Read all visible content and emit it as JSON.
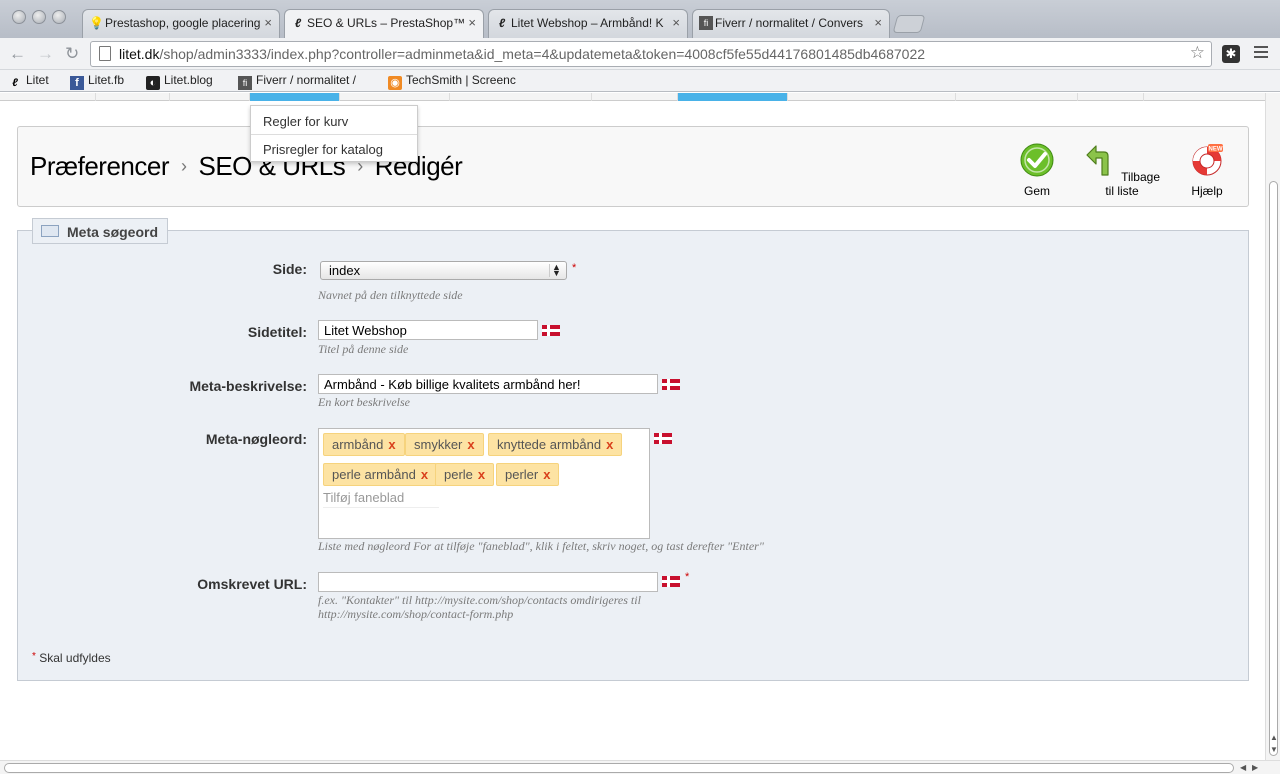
{
  "browser": {
    "tabs": [
      {
        "title": "Prestashop, google placering",
        "icon": "lightbulb-icon",
        "close": "×"
      },
      {
        "title": "SEO & URLs – PrestaShop™",
        "icon": "litet-logo-icon",
        "close": "×"
      },
      {
        "title": "Litet Webshop – Armbånd! K",
        "icon": "litet-logo-icon",
        "close": "×"
      },
      {
        "title": "Fiverr / normalitet / Convers",
        "icon": "fiverr-icon",
        "close": "×"
      }
    ],
    "url_host": "litet.dk",
    "url_path": "/shop/admin3333/index.php?controller=adminmeta&id_meta=4&updatemeta&token=4008cf5fe55d44176801485db4687022",
    "bookmarks": [
      {
        "label": "Litet",
        "icon": "litet-logo-icon"
      },
      {
        "label": "Litet.fb",
        "icon": "facebook-icon"
      },
      {
        "label": "Litet.blog",
        "icon": "blog-icon"
      },
      {
        "label": "Fiverr / normalitet /",
        "icon": "fiverr-icon"
      },
      {
        "label": "TechSmith | Screenc",
        "icon": "rss-icon"
      }
    ]
  },
  "dropdown": {
    "items": [
      "Regler for kurv",
      "Prisregler for katalog"
    ]
  },
  "header": {
    "breadcrumb": [
      "Præferencer",
      "SEO & URLs",
      "Redigér"
    ],
    "breadcrumb_sep": "›",
    "save_label": "Gem",
    "back_label": "Tilbage til liste",
    "help_label": "Hjælp"
  },
  "form": {
    "legend": "Meta søgeord",
    "side_label": "Side:",
    "side_value": "index",
    "side_hint": "Navnet på den tilknyttede side",
    "title_label": "Sidetitel:",
    "title_value": "Litet Webshop",
    "title_hint": "Titel på denne side",
    "desc_label": "Meta-beskrivelse:",
    "desc_value": "Armbånd - Køb billige kvalitets armbånd her!",
    "desc_hint": "En kort beskrivelse",
    "keywords_label": "Meta-nøgleord:",
    "keywords": [
      "armbånd",
      "smykker",
      "knyttede armbånd",
      "perle armbånd",
      "perle",
      "perler"
    ],
    "tag_remove": "x",
    "keywords_placeholder": "Tilføj faneblad",
    "keywords_hint": "Liste med nøgleord For at tilføje \"faneblad\", klik i feltet, skriv noget, og tast derefter \"Enter\"",
    "url_label": "Omskrevet URL:",
    "url_value": "",
    "url_hint_1": "f.ex. \"Kontakter\" til http://mysite.com/shop/contacts omdirigeres til",
    "url_hint_2": "http://mysite.com/shop/contact-form.php",
    "required_mark": "*",
    "required_note": "Skal udfyldes"
  },
  "colors": {
    "accent_nav": "#49b2e8",
    "tag_bg": "#fde3a3",
    "flag_red": "#c8102e",
    "panel_bg": "#ecf0f5"
  }
}
